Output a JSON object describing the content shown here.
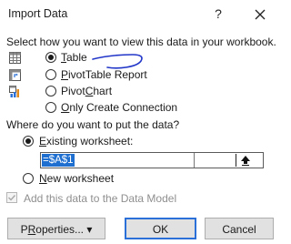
{
  "dialog": {
    "title": "Import Data",
    "help_glyph": "?",
    "prompt_view": "Select how you want to view this data in your workbook.",
    "view_options": [
      {
        "key": "T",
        "rest": "able",
        "checked": true,
        "icon": "table-icon"
      },
      {
        "key": "P",
        "rest": "ivotTable Report",
        "checked": false,
        "icon": "pivottable-icon"
      },
      {
        "pre": "Pivot",
        "key": "C",
        "rest": "hart",
        "checked": false,
        "icon": "pivotchart-icon"
      },
      {
        "key": "O",
        "rest": "nly Create Connection",
        "checked": false,
        "icon": "connection-icon"
      }
    ],
    "prompt_location": "Where do you want to put the data?",
    "existing": {
      "key": "E",
      "rest": "xisting worksheet:",
      "checked": true
    },
    "reference_value": "=$A$1",
    "new_ws": {
      "key": "N",
      "rest": "ew worksheet",
      "checked": false
    },
    "data_model_label": "Add this data to the Data Model",
    "properties_key": "R",
    "properties_pre": "P",
    "properties_rest": "operties...",
    "properties_arrow": "▾",
    "ok_label": "OK",
    "cancel_label": "Cancel",
    "accent_color": "#2a70d8",
    "selection_color": "#1f6fd1"
  }
}
